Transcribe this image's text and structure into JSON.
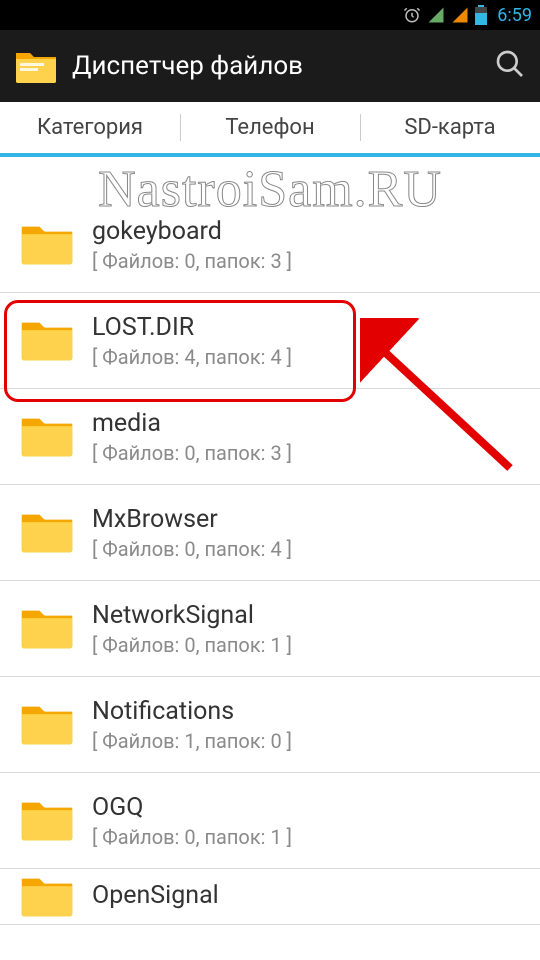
{
  "status": {
    "time": "6:59"
  },
  "header": {
    "title": "Диспетчер файлов"
  },
  "tabs": {
    "category": "Категория",
    "phone": "Телефон",
    "sdcard": "SD-карта"
  },
  "watermark": "NastroiSam.RU",
  "folders": [
    {
      "name": "gokeyboard",
      "sub": "[ Файлов: 0, папок: 3 ]"
    },
    {
      "name": "LOST.DIR",
      "sub": "[ Файлов: 4, папок: 4 ]"
    },
    {
      "name": "media",
      "sub": "[ Файлов: 0, папок: 3 ]"
    },
    {
      "name": "MxBrowser",
      "sub": "[ Файлов: 0, папок: 4 ]"
    },
    {
      "name": "NetworkSignal",
      "sub": "[ Файлов: 0, папок: 1 ]"
    },
    {
      "name": "Notifications",
      "sub": "[ Файлов: 1, папок: 0 ]"
    },
    {
      "name": "OGQ",
      "sub": "[ Файлов: 0, папок: 1 ]"
    },
    {
      "name": "OpenSignal",
      "sub": ""
    }
  ]
}
